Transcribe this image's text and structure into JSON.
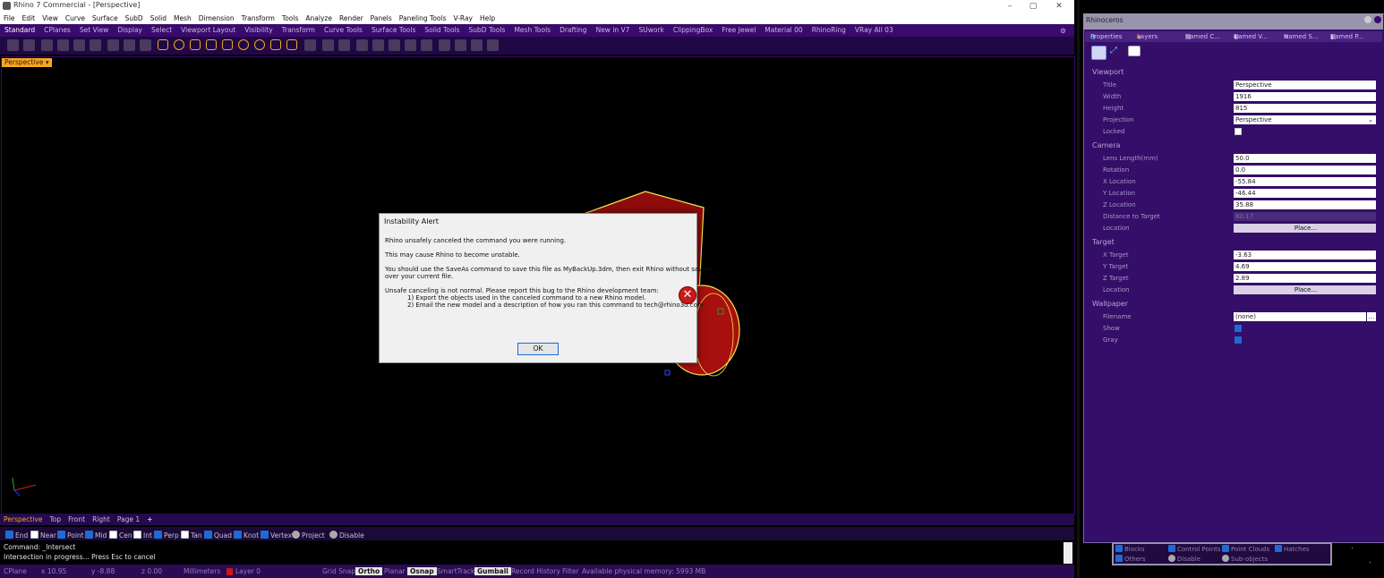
{
  "window": {
    "title": "Rhino 7 Commercial - [Perspective]",
    "controls": [
      "–",
      "▢",
      "✕"
    ]
  },
  "menu": [
    "File",
    "Edit",
    "View",
    "Curve",
    "Surface",
    "SubD",
    "Solid",
    "Mesh",
    "Dimension",
    "Transform",
    "Tools",
    "Analyze",
    "Render",
    "Panels",
    "Paneling Tools",
    "V-Ray",
    "Help"
  ],
  "toolbar_tabs": [
    "Standard",
    "CPlanes",
    "Set View",
    "Display",
    "Select",
    "Viewport Layout",
    "Visibility",
    "Transform",
    "Curve Tools",
    "Surface Tools",
    "Solid Tools",
    "SubD Tools",
    "Mesh Tools",
    "Drafting",
    "New in V7",
    "SUwork",
    "ClippingBox",
    "Free Jewel",
    "Material 00",
    "RhinoRing",
    "VRay All 03"
  ],
  "viewport": {
    "label": "Perspective"
  },
  "viewport_tabs": [
    "Perspective",
    "Top",
    "Front",
    "Right",
    "Page 1",
    "+"
  ],
  "osnaps": [
    {
      "label": "End",
      "on": true
    },
    {
      "label": "Near",
      "on": false
    },
    {
      "label": "Point",
      "on": true
    },
    {
      "label": "Mid",
      "on": true
    },
    {
      "label": "Cen",
      "on": false
    },
    {
      "label": "Int",
      "on": false
    },
    {
      "label": "Perp",
      "on": true
    },
    {
      "label": "Tan",
      "on": false
    },
    {
      "label": "Quad",
      "on": true
    },
    {
      "label": "Knot",
      "on": true
    },
    {
      "label": "Vertex",
      "on": true
    },
    {
      "label": "Project",
      "on": false
    },
    {
      "label": "Disable",
      "on": false
    }
  ],
  "command": {
    "line1": "Command: _Intersect",
    "line2": "Intersection in progress... Press Esc to cancel"
  },
  "status": {
    "cplane": "CPlane",
    "x": "x 10.95",
    "y": "y -8.88",
    "z": "z 0.00",
    "units": "Millimeters",
    "layer": "Layer 0",
    "grid_snap": "Grid Snap",
    "ortho": "Ortho",
    "planar": "Planar",
    "osnap": "Osnap",
    "smarttrack": "SmartTrack",
    "gumball": "Gumball",
    "record_history": "Record History",
    "filter": "Filter",
    "memory": "Available physical memory: 5993 MB"
  },
  "dialog": {
    "title": "Instability Alert",
    "line1": "Rhino unsafely canceled the command you were running.",
    "line2": "This may cause Rhino to become unstable.",
    "line3a": "You should use the SaveAs command to save this file as MyBackUp.3dm, then exit Rhino without saving",
    "line3b": "over your current file.",
    "line4": "Unsafe canceling is not normal. Please report this bug to the Rhino development team:",
    "line5": "1) Export the objects used in the canceled command to a new Rhino model.",
    "line6": "2) Email the new model and a description of how you ran this command to tech@rhino3d.com.",
    "ok": "OK",
    "error_glyph": "✕"
  },
  "panel": {
    "title": "Rhinoceros",
    "tabs": [
      "Properties",
      "Layers",
      "Named C...",
      "Named V...",
      "Named S...",
      "Named P..."
    ],
    "viewport_section": "Viewport",
    "title_label": "Title",
    "title_value": "Perspective",
    "width_label": "Width",
    "width_value": "1916",
    "height_label": "Height",
    "height_value": "815",
    "projection_label": "Projection",
    "projection_value": "Perspective",
    "locked_label": "Locked",
    "camera_section": "Camera",
    "lens_label": "Lens Length(mm)",
    "lens_value": "50.0",
    "rotation_label": "Rotation",
    "rotation_value": "0.0",
    "xloc_label": "X Location",
    "xloc_value": "-55.84",
    "yloc_label": "Y Location",
    "yloc_value": "-46.44",
    "zloc_label": "Z Location",
    "zloc_value": "35.88",
    "dist_label": "Distance to Target",
    "dist_value": "80.17",
    "loc_label": "Location",
    "place": "Place...",
    "target_section": "Target",
    "xt_label": "X Target",
    "xt_value": "-3.63",
    "yt_label": "Y Target",
    "yt_value": "4.69",
    "zt_label": "Z Target",
    "zt_value": "2.89",
    "tloc_label": "Location",
    "wallpaper_section": "Wallpaper",
    "filename_label": "Filename",
    "filename_value": "(none)",
    "browse": "...",
    "show_label": "Show",
    "gray_label": "Gray"
  },
  "mini": {
    "blocks": "Blocks",
    "control_points": "Control Points",
    "point_clouds": "Point Clouds",
    "hatches": "Hatches",
    "others": "Others",
    "disable": "Disable",
    "sub_objects": "Sub-objects"
  },
  "colors": {
    "accent": "#f5a623",
    "panel_bg": "#340e68",
    "toolbar_bg": "#3a0a6e",
    "model_red": "#a80f0f",
    "edge_yellow": "#f2e94e"
  }
}
